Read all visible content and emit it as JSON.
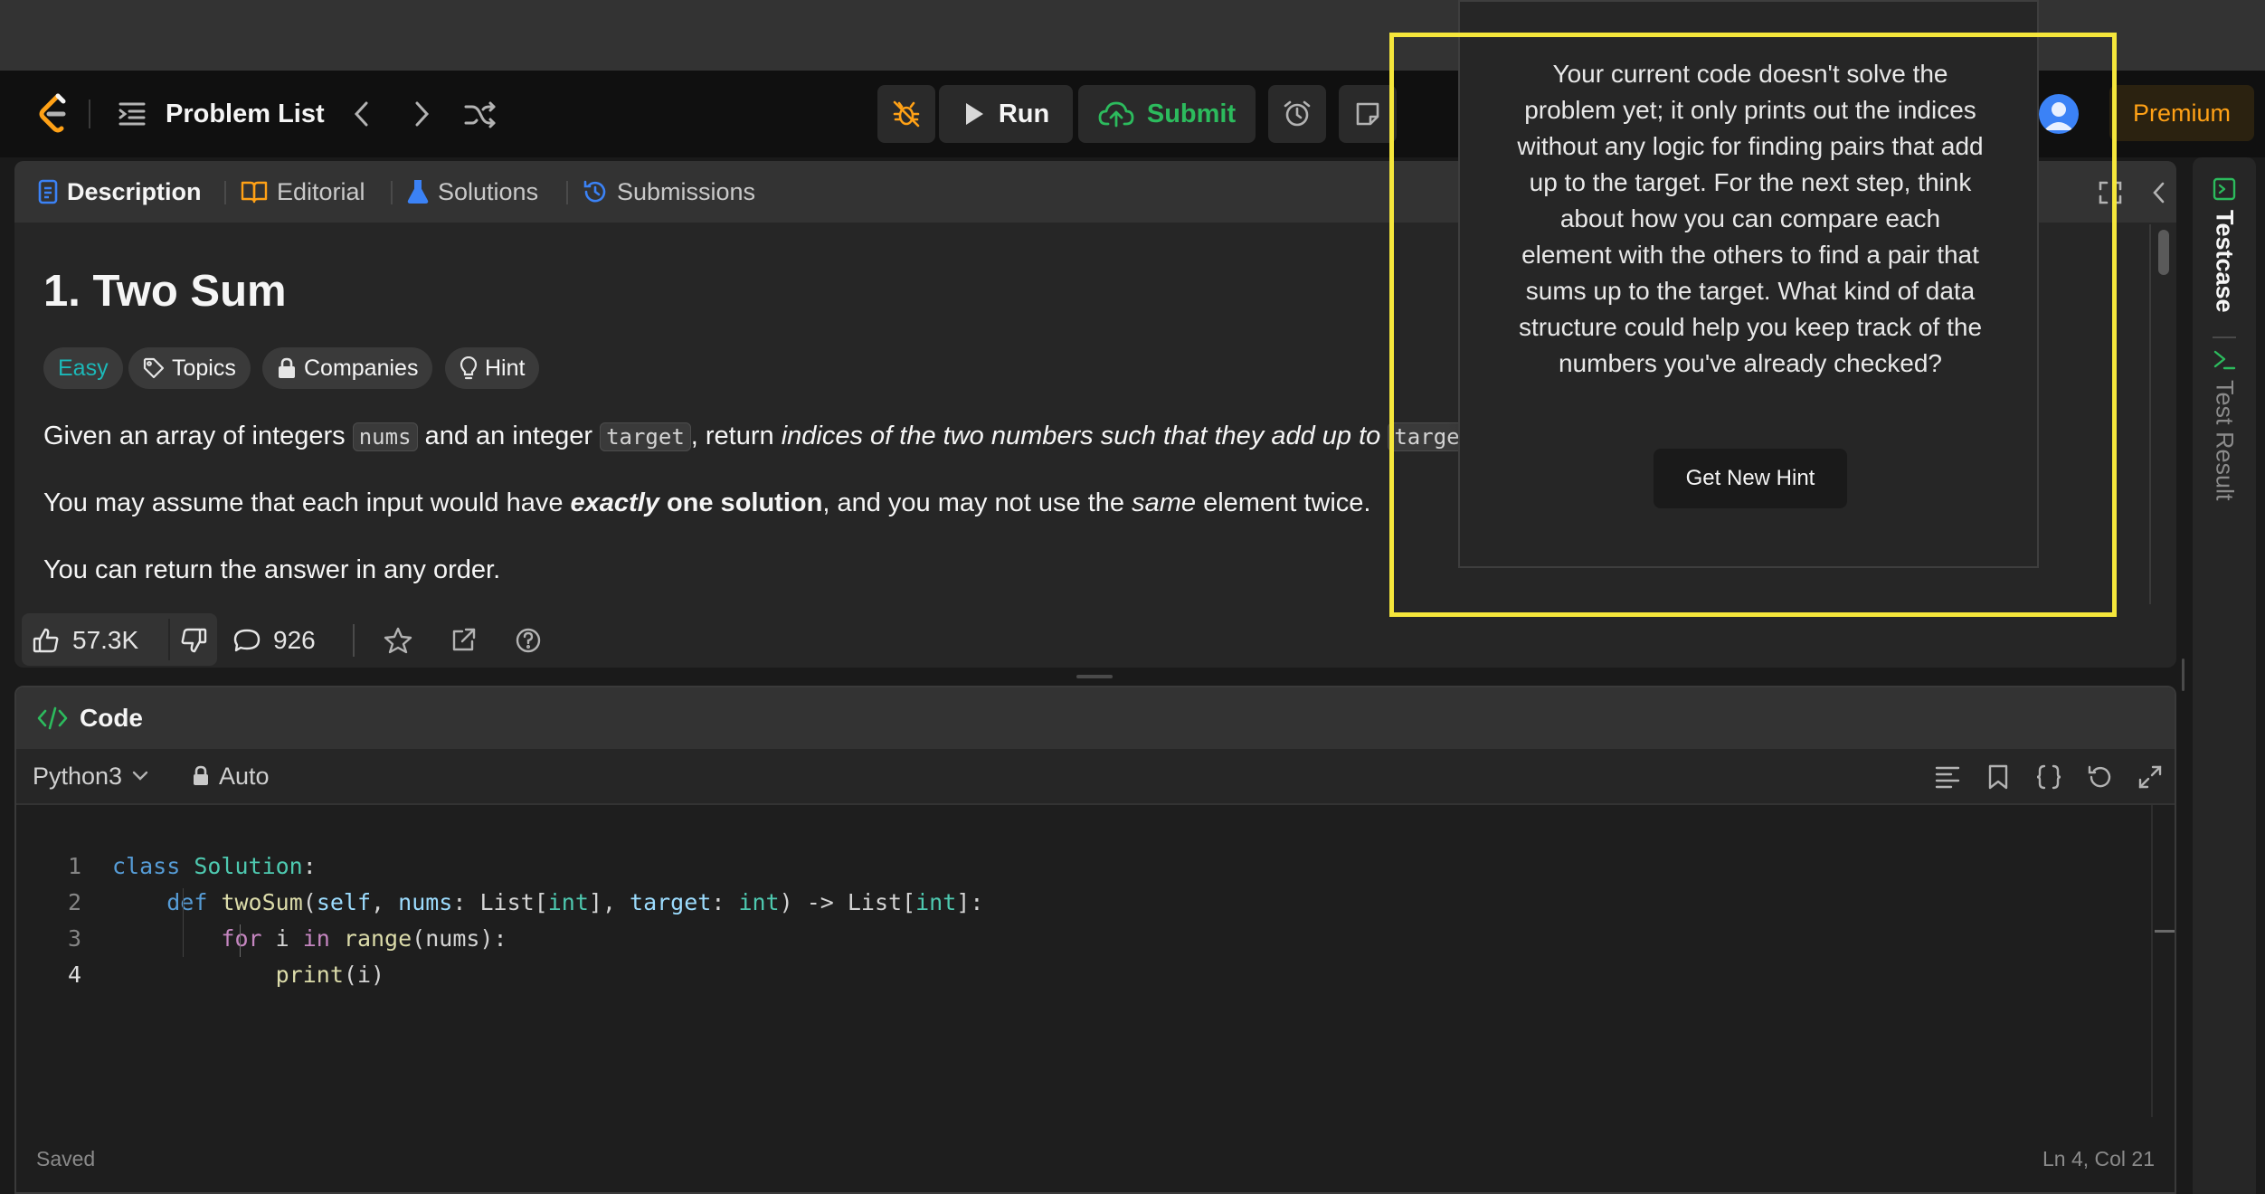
{
  "navbar": {
    "problem_list_label": "Problem List",
    "run_label": "Run",
    "submit_label": "Submit",
    "premium_label": "Premium"
  },
  "description": {
    "tabs": [
      {
        "label": "Description",
        "icon": "description-icon",
        "active": true
      },
      {
        "label": "Editorial",
        "icon": "book-icon",
        "active": false
      },
      {
        "label": "Solutions",
        "icon": "flask-icon",
        "active": false
      },
      {
        "label": "Submissions",
        "icon": "history-icon",
        "active": false
      }
    ],
    "title": "1. Two Sum",
    "tags": {
      "difficulty": "Easy",
      "topics": "Topics",
      "companies": "Companies",
      "hint": "Hint"
    },
    "para1": {
      "t1": "Given an array of integers ",
      "c1": "nums",
      "t2": " and an integer ",
      "c2": "target",
      "t3": ", return ",
      "em1": "indices of the two numbers such that they add up to ",
      "c3": "target"
    },
    "para2": {
      "t1": "You may assume that each input would have ",
      "strong_em": "exactly",
      "strong": " one solution",
      "t2": ", and you may not use the ",
      "em": "same",
      "t3": " element twice."
    },
    "para3": "You can return the answer in any order.",
    "likes": "57.3K",
    "comments": "926"
  },
  "code": {
    "title": "Code",
    "language": "Python3",
    "mode": "Auto",
    "lines": [
      {
        "n": "1"
      },
      {
        "n": "2"
      },
      {
        "n": "3"
      },
      {
        "n": "4"
      }
    ],
    "status_left": "Saved",
    "status_right": "Ln 4, Col 21"
  },
  "right_strip": {
    "testcase_label": "Testcase",
    "test_result_label": "Test Result"
  },
  "hint_overlay": {
    "text": "Your current code doesn't solve the problem yet; it only prints out the indices without any logic for finding pairs that add up to the target. For the next step, think about how you can compare each element with the others to find a pair that sums up to the target. What kind of data structure could help you keep track of the numbers you've already checked?",
    "button_label": "Get New Hint",
    "highlight_color": "#f5e63b"
  },
  "colors": {
    "accent_orange": "#ffa116",
    "submit_green": "#2cbb5d",
    "easy_teal": "#1cb8b8"
  }
}
